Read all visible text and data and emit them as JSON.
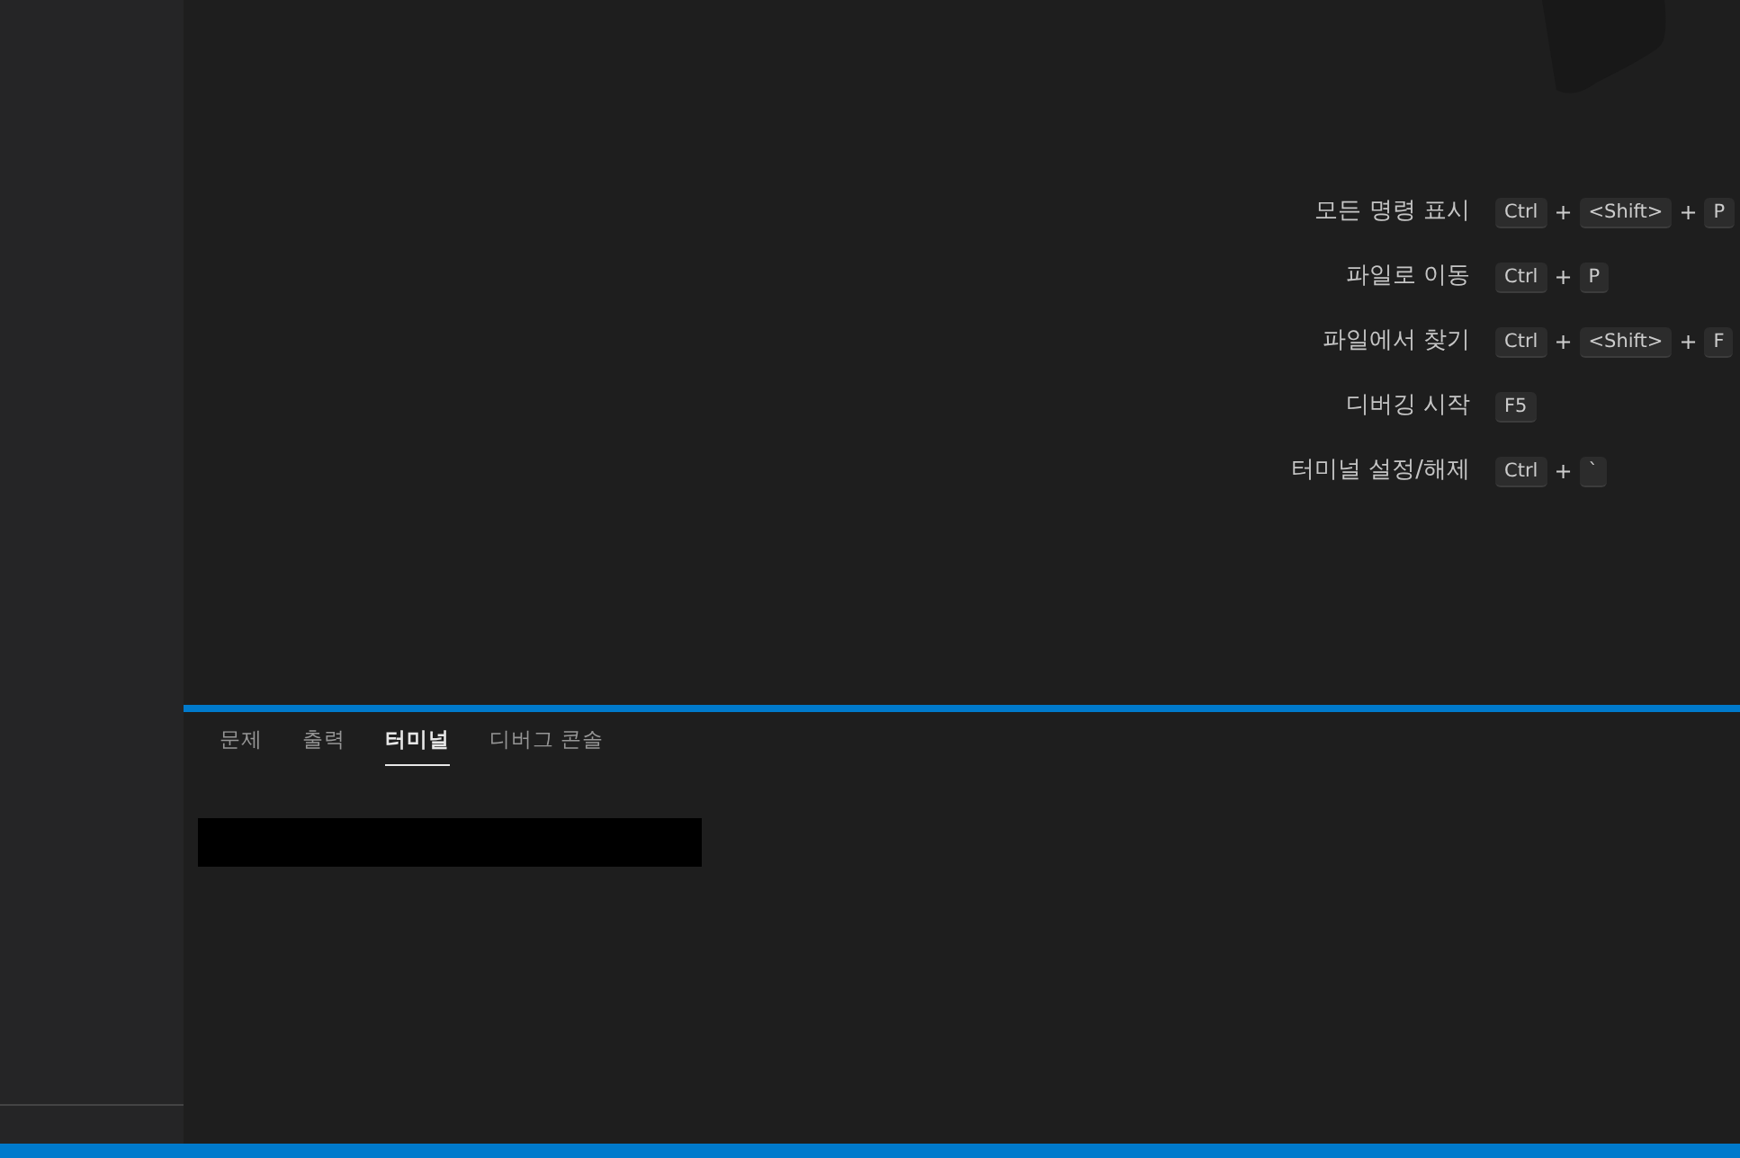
{
  "shortcuts": [
    {
      "label": "모든 명령 표시",
      "keys": [
        {
          "kind": "key",
          "text": "Ctrl"
        },
        {
          "kind": "plus",
          "text": "+"
        },
        {
          "kind": "key",
          "text": "<Shift>"
        },
        {
          "kind": "plus",
          "text": "+"
        },
        {
          "kind": "key",
          "text": "P"
        }
      ]
    },
    {
      "label": "파일로 이동",
      "keys": [
        {
          "kind": "key",
          "text": "Ctrl"
        },
        {
          "kind": "plus",
          "text": "+"
        },
        {
          "kind": "key",
          "text": "P"
        }
      ]
    },
    {
      "label": "파일에서 찾기",
      "keys": [
        {
          "kind": "key",
          "text": "Ctrl"
        },
        {
          "kind": "plus",
          "text": "+"
        },
        {
          "kind": "key",
          "text": "<Shift>"
        },
        {
          "kind": "plus",
          "text": "+"
        },
        {
          "kind": "key",
          "text": "F"
        }
      ]
    },
    {
      "label": "디버깅 시작",
      "keys": [
        {
          "kind": "key",
          "text": "F5"
        }
      ]
    },
    {
      "label": "터미널 설정/해제",
      "keys": [
        {
          "kind": "key",
          "text": "Ctrl"
        },
        {
          "kind": "plus",
          "text": "+"
        },
        {
          "kind": "key",
          "text": "`"
        }
      ]
    }
  ],
  "panel": {
    "tabs": [
      {
        "label": "문제",
        "selected": false
      },
      {
        "label": "출력",
        "selected": false
      },
      {
        "label": "터미널",
        "selected": true
      },
      {
        "label": "디버그 콘솔",
        "selected": false
      }
    ]
  }
}
